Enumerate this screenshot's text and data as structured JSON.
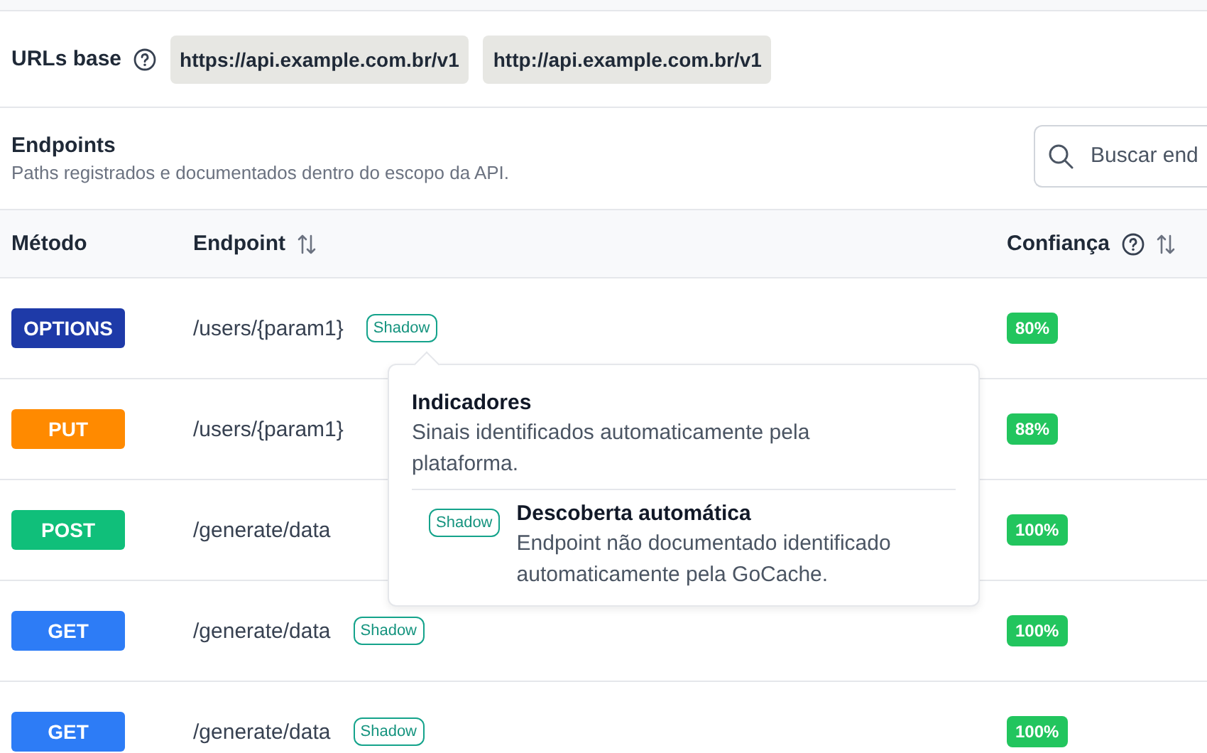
{
  "base_urls": {
    "label": "URLs base",
    "urls": [
      "https://api.example.com.br/v1",
      "http://api.example.com.br/v1"
    ]
  },
  "endpoints": {
    "title": "Endpoints",
    "subtitle": "Paths registrados e documentados dentro do escopo da API.",
    "search": {
      "placeholder": "Buscar end"
    }
  },
  "table": {
    "columns": [
      {
        "label": "Método",
        "sortable": false,
        "help": false
      },
      {
        "label": "Endpoint",
        "sortable": true,
        "help": false
      },
      {
        "label": "Confiança",
        "sortable": true,
        "help": true
      }
    ],
    "rows": [
      {
        "method": "OPTIONS",
        "color": "#1e3aa8",
        "path": "/users/{param1}",
        "tag": "Shadow",
        "confidence": "80%"
      },
      {
        "method": "PUT",
        "color": "#ff8a00",
        "path": "/users/{param1}",
        "confidence": "88%"
      },
      {
        "method": "POST",
        "color": "#10bf7a",
        "path": "/generate/data",
        "confidence": "100%"
      },
      {
        "method": "GET",
        "color": "#2d7cf6",
        "path": "/generate/data",
        "tag": "Shadow",
        "confidence": "100%"
      },
      {
        "method": "GET",
        "color": "#2d7cf6",
        "path": "/generate/data",
        "tag": "Shadow",
        "confidence": "100%"
      }
    ]
  },
  "tooltip": {
    "title": "Indicadores",
    "text": "Sinais identificados automaticamente pela plataforma.",
    "items": [
      {
        "tag": "Shadow",
        "title": "Descoberta automática",
        "text": "Endpoint não documentado identificado automaticamente pela GoCache."
      }
    ]
  }
}
